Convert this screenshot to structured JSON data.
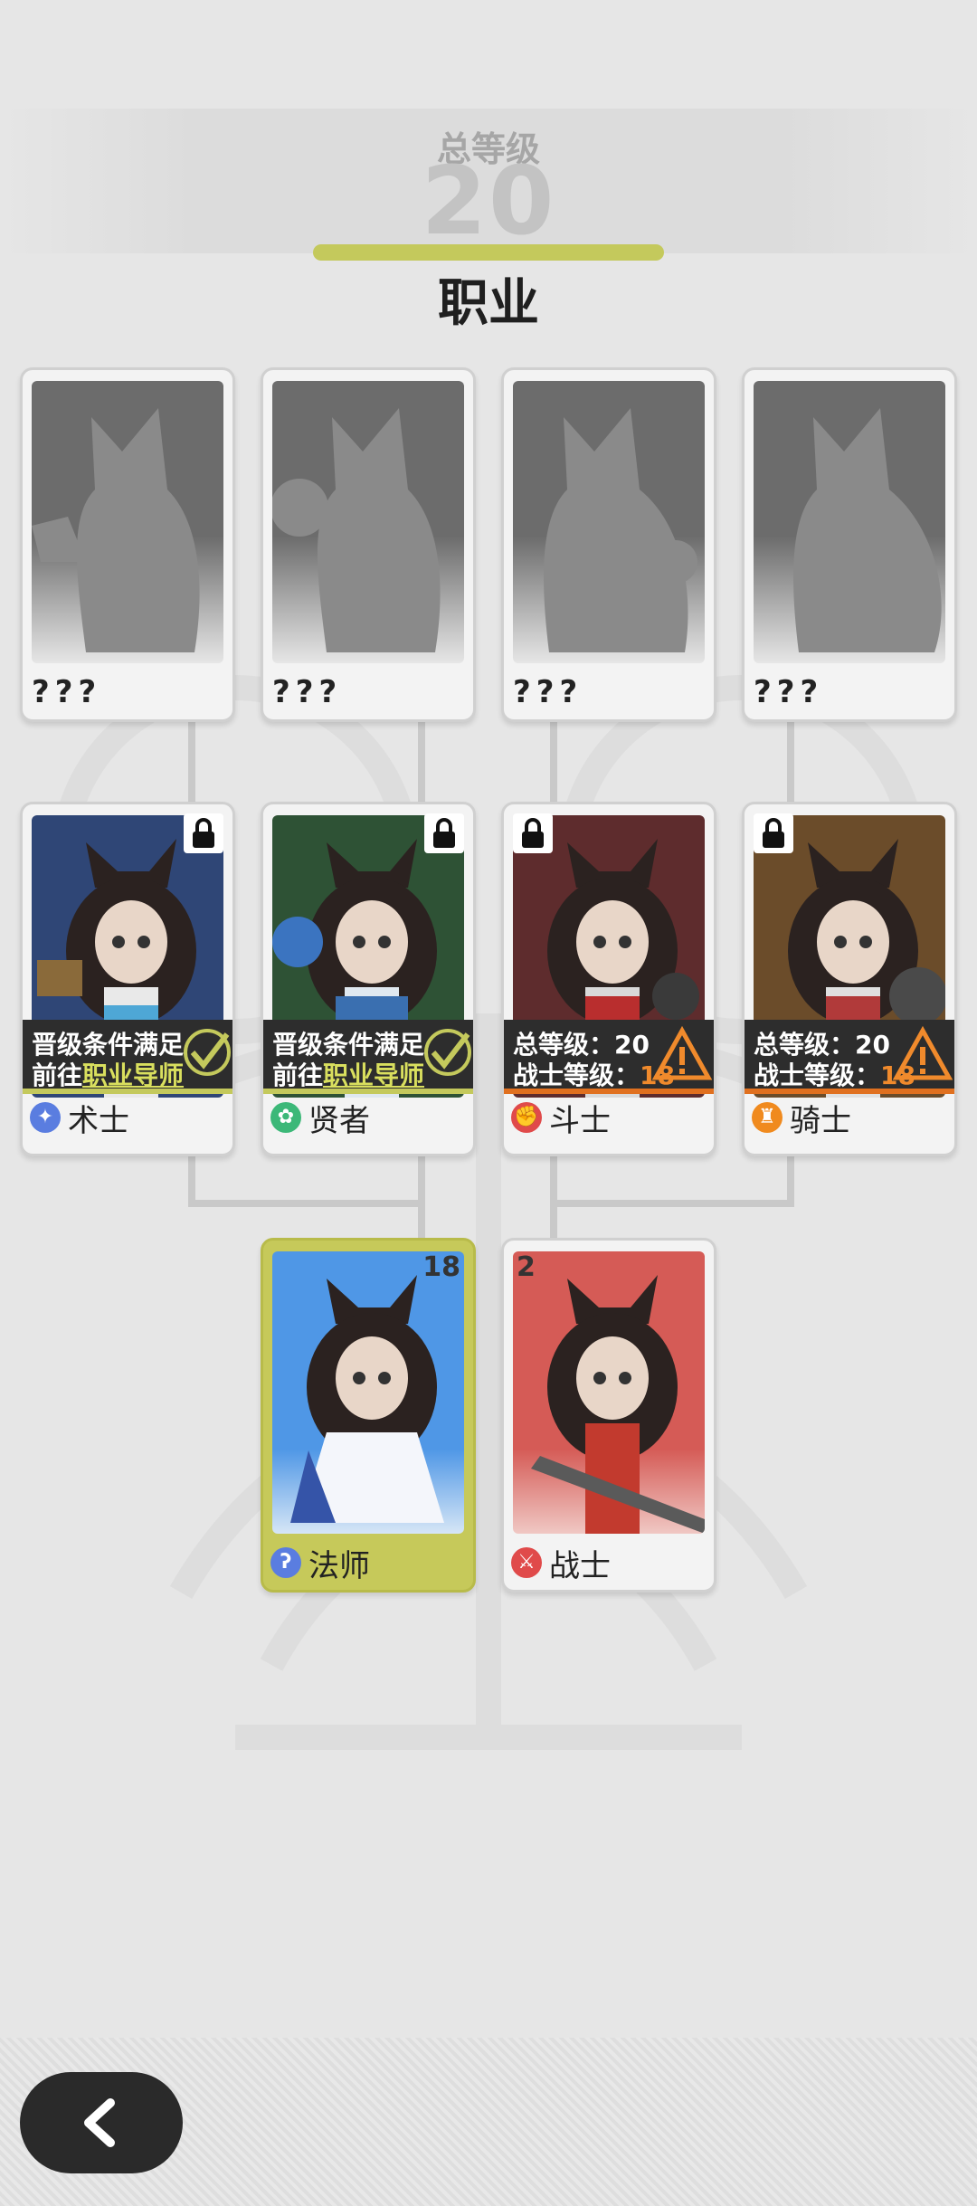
{
  "header": {
    "total_level_label": "总等级",
    "total_level_value": "20",
    "title": "职业"
  },
  "tiers": {
    "top": [
      {
        "name": "???"
      },
      {
        "name": "???"
      },
      {
        "name": "???"
      },
      {
        "name": "???"
      }
    ],
    "middle": [
      {
        "name": "术士",
        "locked": true,
        "status_line1": "晋级条件满足",
        "status_line2_prefix": "前往",
        "status_line2_link": "职业导师",
        "state": "ready",
        "color": "#2f4676",
        "icon_color": "#5a7de0"
      },
      {
        "name": "贤者",
        "locked": true,
        "status_line1": "晋级条件满足",
        "status_line2_prefix": "前往",
        "status_line2_link": "职业导师",
        "state": "ready",
        "color": "#2e5235",
        "icon_color": "#3cb878"
      },
      {
        "name": "斗士",
        "locked": true,
        "req1_label": "总等级：",
        "req1_value": "20",
        "req2_label": "战士等级：",
        "req2_value": "18",
        "state": "warning",
        "color": "#5e2c2d",
        "icon_color": "#e04a4a"
      },
      {
        "name": "骑士",
        "locked": true,
        "req1_label": "总等级：",
        "req1_value": "20",
        "req2_label": "战士等级：",
        "req2_value": "18",
        "state": "warning",
        "color": "#6b4c2a",
        "icon_color": "#f08a1e"
      }
    ],
    "bottom": [
      {
        "name": "法师",
        "level": "18",
        "selected": true,
        "color_top": "#4f97e6",
        "color_bottom": "#d6e6f6",
        "icon_color": "#5a7de0"
      },
      {
        "name": "战士",
        "level": "2",
        "selected": false,
        "color_top": "#d55b56",
        "color_bottom": "#f0c8c4",
        "icon_color": "#e04a4a"
      }
    ]
  },
  "icons": {
    "lock": "lock-icon",
    "check": "check-icon",
    "warning": "warning-icon",
    "back": "chevron-left-icon"
  },
  "colors": {
    "accent": "#c4c95c",
    "warning": "#f08a2c"
  }
}
